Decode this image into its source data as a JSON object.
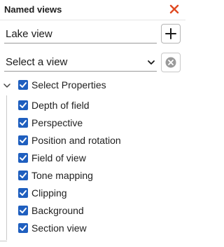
{
  "panel": {
    "title": "Named views"
  },
  "name_input": {
    "value": "Lake view"
  },
  "view_select": {
    "selected": "Select a view"
  },
  "properties": {
    "root_label": "Select Properties",
    "root_checked": true,
    "items": [
      {
        "label": "Depth of field",
        "checked": true
      },
      {
        "label": "Perspective",
        "checked": true
      },
      {
        "label": "Position and rotation",
        "checked": true
      },
      {
        "label": "Field of view",
        "checked": true
      },
      {
        "label": "Tone mapping",
        "checked": true
      },
      {
        "label": "Clipping",
        "checked": true
      },
      {
        "label": "Background",
        "checked": true
      },
      {
        "label": "Section view",
        "checked": true
      }
    ]
  },
  "colors": {
    "accent": "#1f5fbf",
    "close": "#e04a22",
    "clear_icon": "#9a9a9a"
  }
}
